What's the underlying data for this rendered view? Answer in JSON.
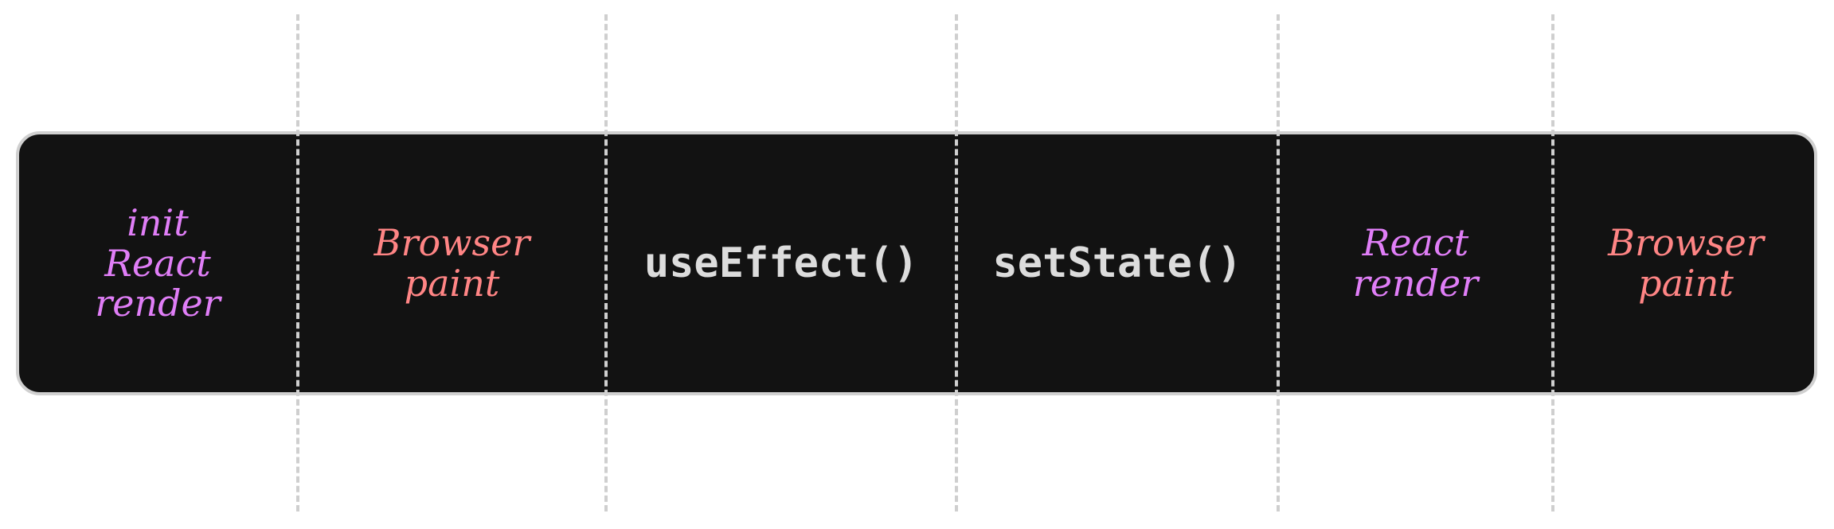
{
  "colors": {
    "band_background": "#121212",
    "band_border": "#d0d0d0",
    "divider": "#cfcfcf",
    "react": "#e07ef7",
    "browser": "#ff8585",
    "code": "#dcdcdc"
  },
  "phases": [
    {
      "lines": [
        "init",
        "React",
        "render"
      ],
      "kind": "react"
    },
    {
      "lines": [
        "Browser",
        "paint"
      ],
      "kind": "browser"
    },
    {
      "lines": [
        "useEffect()"
      ],
      "kind": "code"
    },
    {
      "lines": [
        "setState()"
      ],
      "kind": "code"
    },
    {
      "lines": [
        "React",
        "render"
      ],
      "kind": "react"
    },
    {
      "lines": [
        "Browser",
        "paint"
      ],
      "kind": "browser"
    }
  ]
}
